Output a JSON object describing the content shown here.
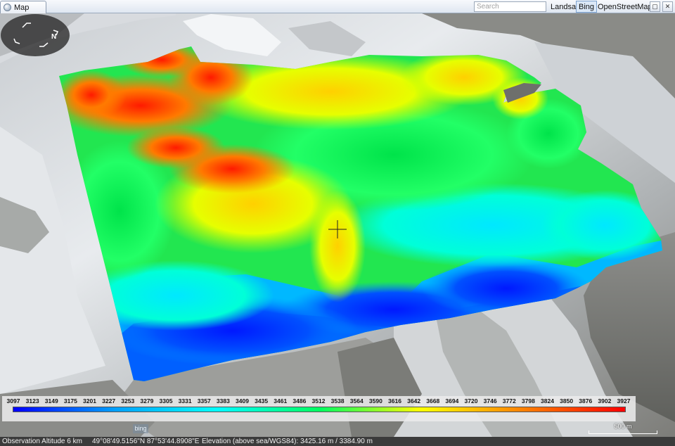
{
  "window": {
    "tab_label": "Map",
    "search_placeholder": "Search",
    "layer_buttons": [
      "Landsat",
      "Bing",
      "OpenStreetMap"
    ],
    "active_layer": "Bing",
    "window_controls": [
      "▢",
      "✕"
    ]
  },
  "map": {
    "crosshair_icon": "crosshair-icon",
    "compass_label": "N",
    "attribution": "bing",
    "scale_label": "500 m"
  },
  "legend": {
    "values": [
      "3097",
      "3123",
      "3149",
      "3175",
      "3201",
      "3227",
      "3253",
      "3279",
      "3305",
      "3331",
      "3357",
      "3383",
      "3409",
      "3435",
      "3461",
      "3486",
      "3512",
      "3538",
      "3564",
      "3590",
      "3616",
      "3642",
      "3668",
      "3694",
      "3720",
      "3746",
      "3772",
      "3798",
      "3824",
      "3850",
      "3876",
      "3902",
      "3927"
    ],
    "colors": [
      "#0000ff",
      "#00a0ff",
      "#00ffff",
      "#00ff60",
      "#ffff00",
      "#ff8000",
      "#ff0000"
    ]
  },
  "status": {
    "altitude": "Observation Altitude 6 km",
    "coordinates": "49°08'49.5156\"N 87°53'44.8908\"E",
    "elevation": "Elevation (above sea/WGS84): 3425.16 m / 3384.90 m"
  }
}
